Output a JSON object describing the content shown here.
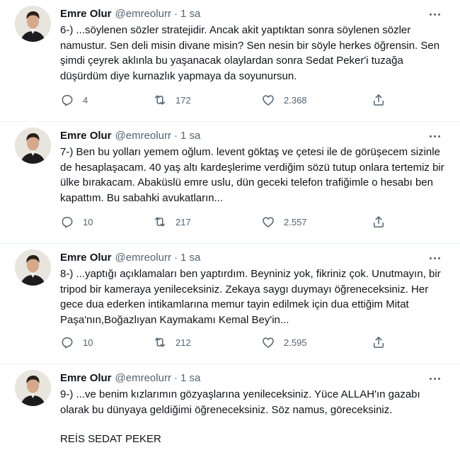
{
  "tweets": [
    {
      "name": "Emre Olur",
      "handle": "@emreolurr",
      "time": "1 sa",
      "text": "6-) ...söylenen sözler stratejidir. Ancak akit yaptıktan sonra söylenen sözler namustur. Sen deli misin divane misin? Sen nesin bir söyle herkes öğrensin. Sen şimdi çeyrek aklınla bu yaşanacak olaylardan sonra Sedat Peker'i tuzağa düşürdüm diye kurnazlık yapmaya da soyunursun.",
      "replies": "4",
      "retweets": "172",
      "likes": "2.368"
    },
    {
      "name": "Emre Olur",
      "handle": "@emreolurr",
      "time": "1 sa",
      "text": "7-) Ben bu yolları yemem oğlum. levent göktaş ve çetesi ile de görüşecem sizinle de hesaplaşacam. 40 yaş altı kardeşlerime verdiğim sözü tutup onlara tertemiz bir ülke bırakacam. Abaküslü emre uslu, dün geceki telefon trafiğimle o hesabı ben kapattım. Bu sabahki avukatların...",
      "replies": "10",
      "retweets": "217",
      "likes": "2.557"
    },
    {
      "name": "Emre Olur",
      "handle": "@emreolurr",
      "time": "1 sa",
      "text": "8-) ...yaptığı açıklamaları ben yaptırdım. Beyniniz yok, fikriniz çok. Unutmayın, bir tripod bir kameraya yenileceksiniz. Zekaya saygı duymayı öğreneceksiniz. Her gece dua ederken intikamlarına memur tayin edilmek için dua ettiğim Mitat Paşa'nın,Boğazlıyan Kaymakamı Kemal Bey'in...",
      "replies": "10",
      "retweets": "212",
      "likes": "2.595"
    },
    {
      "name": "Emre Olur",
      "handle": "@emreolurr",
      "time": "1 sa",
      "text": "9-) ...ve benim kızlarımın gözyaşlarına yenileceksiniz. Yüce ALLAH'ın gazabı olarak bu dünyaya geldiğimi öğreneceksiniz. Söz namus, göreceksiniz.",
      "signature": "REİS SEDAT PEKER"
    }
  ],
  "icons": {
    "more": "more-horizontal-icon",
    "reply": "reply-icon",
    "retweet": "retweet-icon",
    "like": "heart-icon",
    "share": "share-icon"
  },
  "colors": {
    "text": "#0f1419",
    "secondary": "#536471",
    "divider": "#eff3f4"
  }
}
